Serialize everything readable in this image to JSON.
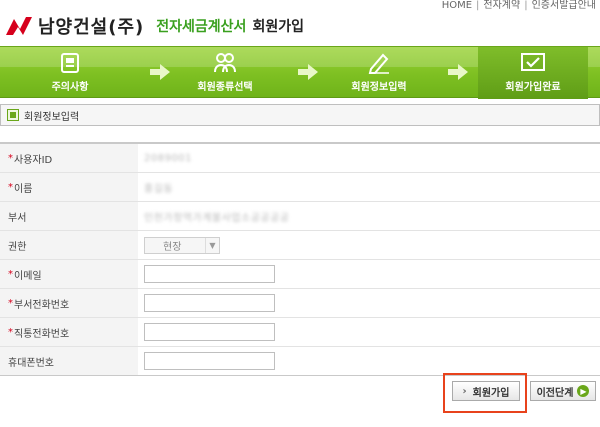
{
  "top_links": [
    "HOME",
    "전자계약",
    "인증서발급안내"
  ],
  "header": {
    "company": "남양건설(주)",
    "system": "전자세금계산서",
    "page": "회원가입"
  },
  "steps": [
    {
      "label": "주의사항",
      "icon": "notepad-icon"
    },
    {
      "label": "회원종류선택",
      "icon": "users-icon"
    },
    {
      "label": "회원정보입력",
      "icon": "pencil-icon"
    },
    {
      "label": "회원가입완료",
      "icon": "checkbox-icon"
    }
  ],
  "section_title": "회원정보입력",
  "form": {
    "user_id": {
      "label": "사용자ID",
      "required": true,
      "value": "2089001"
    },
    "name": {
      "label": "이름",
      "required": true,
      "value": "홍길동"
    },
    "department": {
      "label": "부서",
      "required": false,
      "value": "인천가정역가계불사업소공공공공"
    },
    "authority": {
      "label": "권한",
      "required": false,
      "value": "현장"
    },
    "email": {
      "label": "이메일",
      "required": true,
      "value": ""
    },
    "dept_phone": {
      "label": "부서전화번호",
      "required": true,
      "value": ""
    },
    "direct_phone": {
      "label": "직통전화번호",
      "required": true,
      "value": ""
    },
    "mobile": {
      "label": "휴대폰번호",
      "required": false,
      "value": ""
    }
  },
  "buttons": {
    "join": "회원가입",
    "prev": "이전단계"
  },
  "colors": {
    "brand_green": "#7ec022",
    "accent_red": "#d6001c",
    "highlight": "#e8431c"
  }
}
